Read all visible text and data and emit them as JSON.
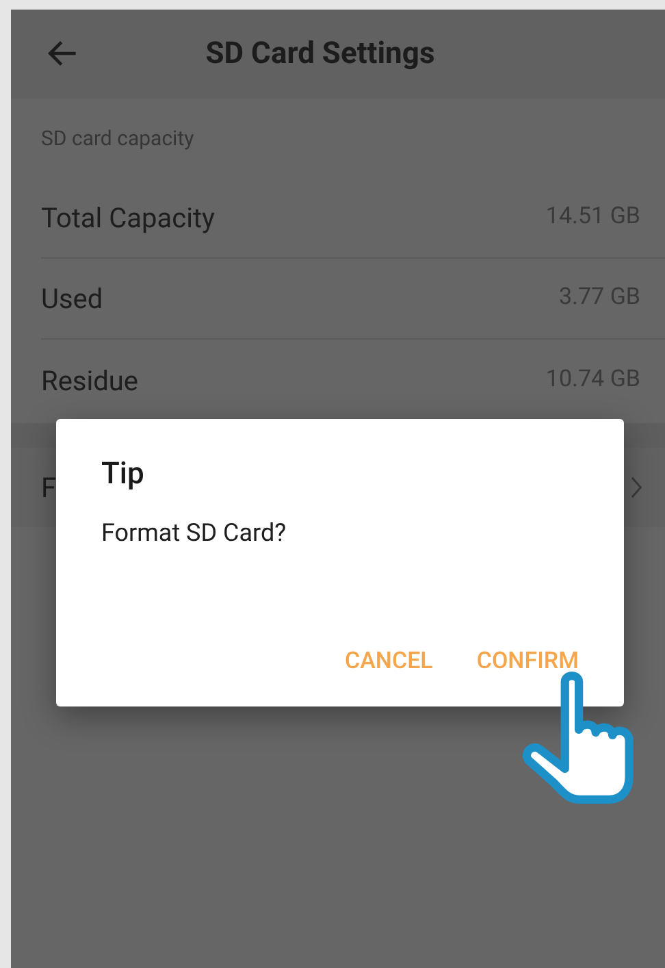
{
  "header": {
    "title": "SD Card Settings"
  },
  "section_label": "SD card capacity",
  "rows": [
    {
      "label": "Total Capacity",
      "value": "14.51 GB"
    },
    {
      "label": "Used",
      "value": "3.77 GB"
    },
    {
      "label": "Residue",
      "value": "10.74 GB"
    }
  ],
  "format_row": {
    "label": "F"
  },
  "dialog": {
    "title": "Tip",
    "message": "Format SD Card?",
    "buttons": [
      "CANCEL",
      "CONFIRM"
    ]
  }
}
